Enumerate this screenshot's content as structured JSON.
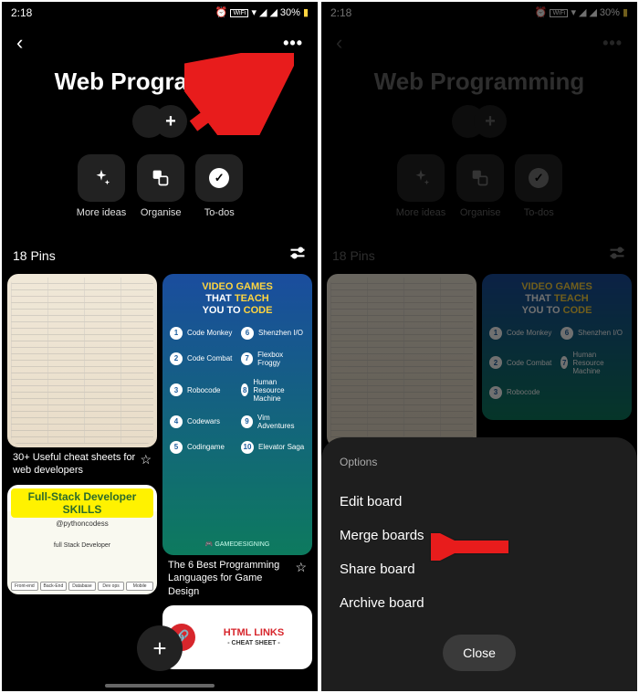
{
  "status": {
    "time": "2:18",
    "battery": "30%"
  },
  "board": {
    "title": "Web Programming",
    "pinCount": "18 Pins"
  },
  "actions": {
    "more": "More ideas",
    "organise": "Organise",
    "todos": "To-dos"
  },
  "pins": {
    "p1": "30+ Useful cheat sheets for web developers",
    "p2_title": "Full-Stack Developer SKILLS",
    "p2_handle": "@pythoncodess",
    "p2_sub": "full Stack Developer",
    "p2_chips": [
      "Front-end",
      "Back-End",
      "Database",
      "Dev ops",
      "Mobile"
    ],
    "p3_title1": "VIDEO GAMES",
    "p3_title2": "THAT ",
    "p3_title3": "TEACH",
    "p3_title4": "YOU TO ",
    "p3_title5": "CODE",
    "p3_items": [
      "Code Monkey",
      "Shenzhen I/O",
      "Code Combat",
      "Flexbox Froggy",
      "Robocode",
      "Human Resource Machine",
      "Codewars",
      "Vim Adventures",
      "Codingame",
      "Elevator Saga"
    ],
    "p3_footer": "GAMEDESIGNING",
    "p3_caption": "The 6 Best Programming Languages for Game Design",
    "p4_main": "HTML LINKS",
    "p4_sub": "- CHEAT SHEET -"
  },
  "sheet": {
    "title": "Options",
    "items": [
      "Edit board",
      "Merge boards",
      "Share board",
      "Archive board"
    ],
    "close": "Close"
  }
}
